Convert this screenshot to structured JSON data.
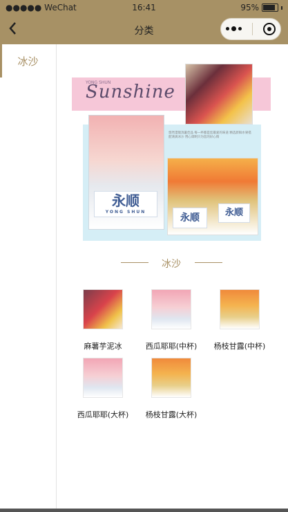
{
  "status_bar": {
    "carrier": "●●●●● WeChat",
    "time": "16:41",
    "battery": "95%"
  },
  "nav": {
    "title": "分类",
    "back_icon": "chevron-left-icon",
    "more_icon": "more-dots-icon",
    "close_icon": "target-circle-icon"
  },
  "sidebar": {
    "items": [
      {
        "label": "冰沙",
        "active": true
      }
    ]
  },
  "banner": {
    "brand": "Sunshine",
    "brand_small": "YONG SHUN",
    "cup_label": "永顺",
    "cup_label_sub": "YONG SHUN",
    "description": "悠然漫哉消暑佳品 每一杯都是您最爱的味道 精选新鲜水果搭配清爽冰沙 用心调制只为您的好心情"
  },
  "section": {
    "title": "冰沙"
  },
  "products": [
    {
      "name": "麻薯芋泥冰",
      "image": "taro"
    },
    {
      "name": "西瓜耶耶(中杯)",
      "image": "melon"
    },
    {
      "name": "杨枝甘露(中杯)",
      "image": "mango"
    },
    {
      "name": "西瓜耶耶(大杯)",
      "image": "melon"
    },
    {
      "name": "杨枝甘露(大杯)",
      "image": "mango"
    }
  ],
  "colors": {
    "header": "#a79165",
    "accent": "#a89064"
  }
}
